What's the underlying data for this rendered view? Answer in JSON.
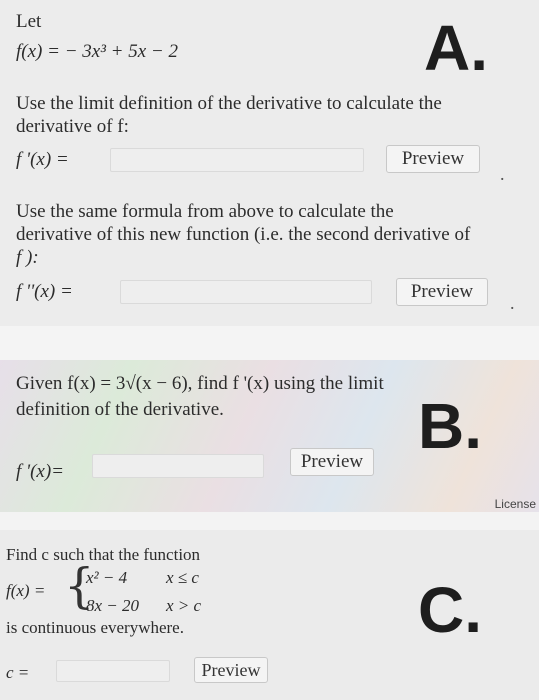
{
  "panelA": {
    "let": "Let",
    "function": "f(x) = − 3x³ + 5x − 2",
    "letter": "A.",
    "instruction1_line1": "Use the limit definition of the derivative to calculate the",
    "instruction1_line2": "derivative of f:",
    "first_label": "f '(x) =",
    "preview1": "Preview",
    "instruction2_line1": "Use the same formula from above to calculate the",
    "instruction2_line2": "derivative of this new function (i.e. the second derivative of",
    "instruction2_line3": "f ):",
    "second_label": "f ''(x) =",
    "preview2": "Preview"
  },
  "panelB": {
    "line1": "Given f(x) = 3√(x − 6), find f '(x) using the limit",
    "line2": "definition of the derivative.",
    "letter": "B.",
    "answer_label": "f '(x)=",
    "preview": "Preview",
    "license": "License"
  },
  "panelC": {
    "line1": "Find c such that the function",
    "f_label": "f(x) =",
    "case1_expr": "x² − 4",
    "case1_cond": "x ≤ c",
    "case2_expr": "8x − 20",
    "case2_cond": "x > c",
    "line2": "is continuous everywhere.",
    "letter": "C.",
    "answer_label": "c =",
    "preview": "Preview"
  }
}
